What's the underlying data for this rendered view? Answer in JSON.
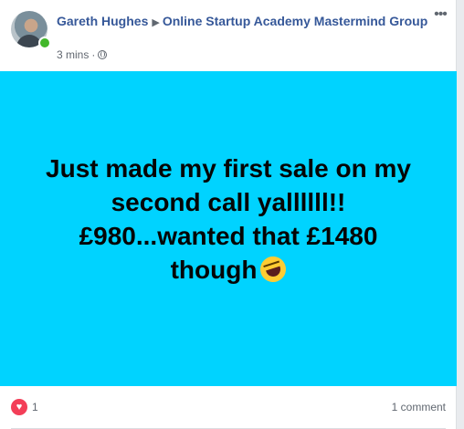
{
  "post": {
    "author": "Gareth Hughes",
    "group": "Online Startup Academy Mastermind Group",
    "time": "3 mins",
    "separator": "·",
    "privacy_icon": "globe-icon",
    "more_icon": "more-options-icon",
    "background_color": "#00d3ff",
    "text_lines": [
      "Just made my first sale on my",
      "second call yallllll!!",
      "£980...wanted that £1480",
      "though"
    ],
    "emoji": "rolling-on-floor-laughing-emoji"
  },
  "footer": {
    "reaction_icon": "love-icon",
    "reaction_count": "1",
    "comments_label": "1 comment"
  }
}
